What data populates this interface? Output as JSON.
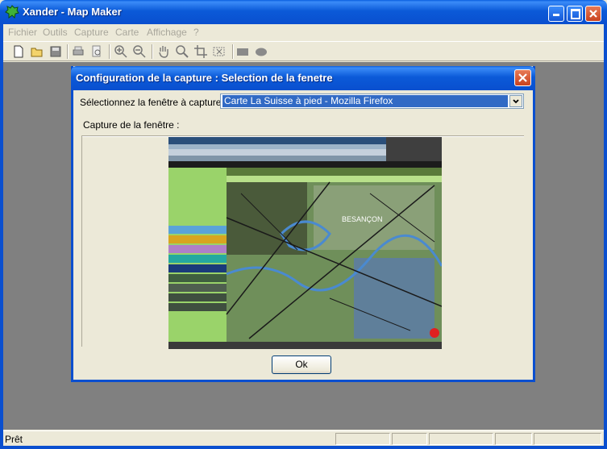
{
  "app": {
    "title": "Xander - Map Maker"
  },
  "menu": {
    "items": [
      "Fichier",
      "Outils",
      "Capture",
      "Carte",
      "Affichage",
      "?"
    ]
  },
  "toolbar": {
    "icons": [
      "new-file-icon",
      "open-folder-icon",
      "save-icon",
      "print-icon",
      "print-preview-icon",
      "zoom-in-icon",
      "zoom-out-icon",
      "pan-hand-icon",
      "zoom-tool-icon",
      "crop-icon",
      "cut-selection-icon",
      "rectangle-icon",
      "ellipse-icon"
    ]
  },
  "dialog": {
    "title": "Configuration de la capture : Selection de la fenetre",
    "select_label": "Sélectionnez la fenêtre à capturer :",
    "select_value": "Carte La Suisse à pied - Mozilla Firefox",
    "capture_label": "Capture de la fenêtre :",
    "ok_label": "Ok",
    "capture_map_label": "BESANÇON"
  },
  "status": {
    "text": "Prêt"
  },
  "colors": {
    "title_blue": "#0a4fcf",
    "workspace_gray": "#808080",
    "dialog_bg": "#ece9d8",
    "selection_blue": "#316ac5"
  }
}
